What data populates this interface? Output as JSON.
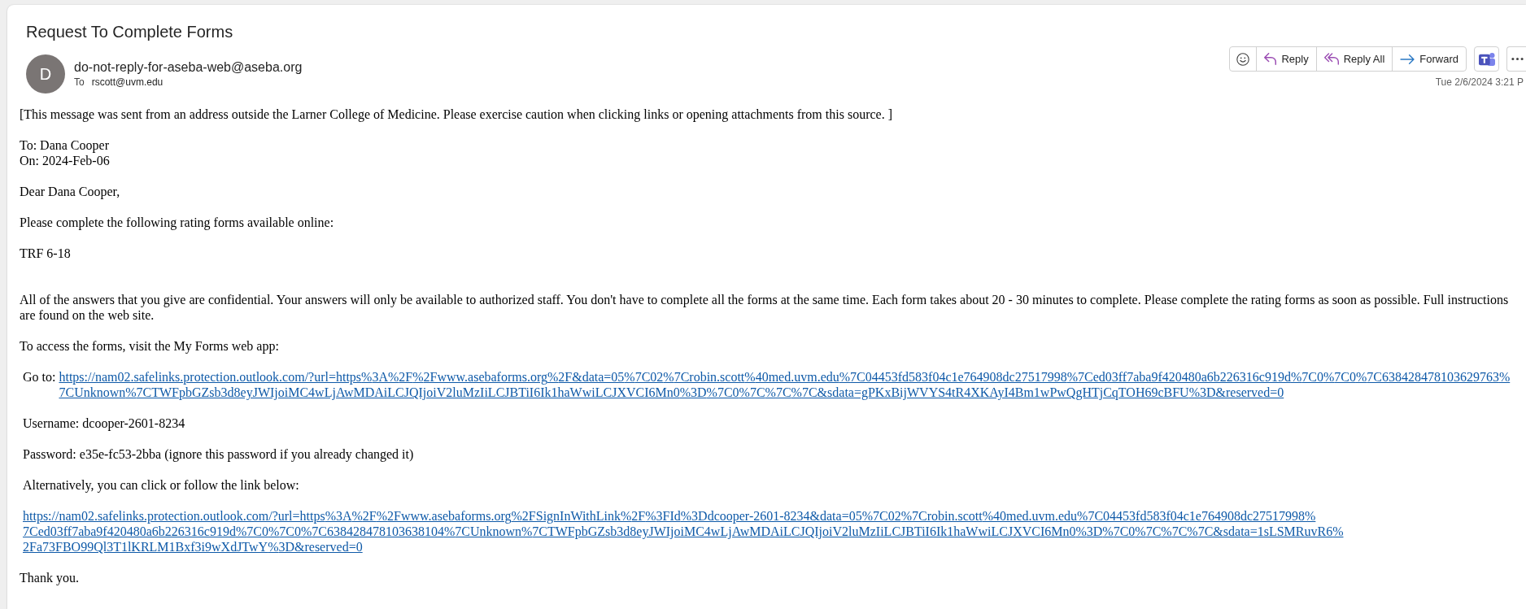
{
  "message": {
    "subject": "Request To Complete Forms",
    "date": "Tue 2/6/2024 3:21 P"
  },
  "sender": {
    "initial": "D",
    "address": "do-not-reply-for-aseba-web@aseba.org",
    "to_label": "To",
    "to": "rscott@uvm.edu"
  },
  "actions": [
    {
      "kind": "react"
    },
    {
      "kind": "reply",
      "label": "Reply"
    },
    {
      "kind": "reply_all",
      "label": "Reply All"
    },
    {
      "kind": "forward",
      "label": "Forward"
    }
  ],
  "extra_buttons": [
    {
      "kind": "app"
    },
    {
      "kind": "more"
    }
  ],
  "body": [
    {
      "kind": "text",
      "text": "[This message was sent from an address outside the Larner College of Medicine. Please exercise caution when clicking links or opening attachments from this source. ]"
    },
    {
      "kind": "lines",
      "lines": [
        "To: Dana Cooper",
        "On: 2024-Feb-06"
      ]
    },
    {
      "kind": "text",
      "text": "Dear Dana Cooper,"
    },
    {
      "kind": "text",
      "text": "Please complete the following rating forms available online:"
    },
    {
      "kind": "form_list",
      "forms": [
        "TRF 6-18"
      ]
    },
    {
      "kind": "text",
      "text": "All of the answers that you give are confidential. Your answers will only be available to authorized staff. You don't have to complete all the forms at the same time. Each form takes about 20 - 30 minutes to complete. Please complete the rating forms as soon as possible. Full instructions are found on the web site."
    },
    {
      "kind": "text",
      "text": "To access the forms, visit the My Forms web app:"
    },
    {
      "kind": "link",
      "label": "Go to:",
      "url": "https://nam02.safelinks.protection.outlook.com/?url=https%3A%2F%2Fwww.asebaforms.org%2F&data=05%7C02%7Crobin.scott%40med.uvm.edu%7C04453fd583f04c1e764908dc27517998%7Ced03ff7aba9f420480a6b226316c919d%7C0%7C0%7C638428478103629763%7CUnknown%7CTWFpbGZsb3d8eyJWIjoiMC4wLjAwMDAiLCJQIjoiV2luMzIiLCJBTiI6Ik1haWwiLCJXVCI6Mn0%3D%7C0%7C%7C%7C&sdata=gPKxBijWVYS4tR4XKAyI4Bm1wPwQgHTjCqTOH69cBFU%3D&reserved=0"
    },
    {
      "kind": "detail",
      "text": "Username: dcooper-2601-8234"
    },
    {
      "kind": "detail",
      "text": "Password: e35e-fc53-2bba (ignore this password if you already changed it)"
    },
    {
      "kind": "detail",
      "text": "Alternatively, you can click or follow the link below:"
    },
    {
      "kind": "link",
      "url": "https://nam02.safelinks.protection.outlook.com/?url=https%3A%2F%2Fwww.asebaforms.org%2FSignInWithLink%2F%3FId%3Ddcooper-2601-8234&data=05%7C02%7Crobin.scott%40med.uvm.edu%7C04453fd583f04c1e764908dc27517998%7Ced03ff7aba9f420480a6b226316c919d%7C0%7C0%7C638428478103638104%7CUnknown%7CTWFpbGZsb3d8eyJWIjoiMC4wLjAwMDAiLCJQIjoiV2luMzIiLCJBTiI6Ik1haWwiLCJXVCI6Mn0%3D%7C0%7C%7C%7C&sdata=1sLSMRuvR6%2Fa73FBO99Ql3T1lKRLM1Bxf3i9wXdJTwY%3D&reserved=0"
    },
    {
      "kind": "text",
      "text": "Thank you."
    }
  ]
}
